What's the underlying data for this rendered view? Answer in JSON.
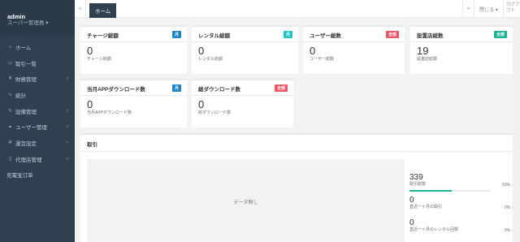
{
  "sidebar": {
    "user": "admin",
    "role": "スーパー管理員 ▾",
    "items": [
      {
        "label": "ホーム",
        "icon": "home-icon",
        "glyph": "⌂",
        "arrow": ""
      },
      {
        "label": "取引一覧",
        "icon": "list-icon",
        "glyph": "▭",
        "arrow": ""
      },
      {
        "label": "財務管理",
        "icon": "yen-icon",
        "glyph": "¥",
        "arrow": "‹"
      },
      {
        "label": "統計",
        "icon": "chart-icon",
        "glyph": "∿",
        "arrow": ""
      },
      {
        "label": "設備管理",
        "icon": "device-icon",
        "glyph": "✎",
        "arrow": "‹"
      },
      {
        "label": "ユーザー管理",
        "icon": "users-icon",
        "glyph": "⚭",
        "arrow": "‹"
      },
      {
        "label": "運営設定",
        "icon": "settings-icon",
        "glyph": "✲",
        "arrow": "‹"
      },
      {
        "label": "代理店管理",
        "icon": "agent-icon",
        "glyph": "▯",
        "arrow": "‹"
      },
      {
        "label": "充電宝订单",
        "icon": "",
        "glyph": "",
        "arrow": ""
      }
    ]
  },
  "topbar": {
    "back": "«",
    "tab_home": "ホーム",
    "forward": "»",
    "close_menu": "閉じる ▾",
    "logout": "ログアウト"
  },
  "cards": [
    {
      "title": "チャージ総額",
      "badge": "月",
      "badge_color": "#1c84c6",
      "value": "0",
      "sub": "チャージ総額"
    },
    {
      "title": "レンタル総額",
      "badge": "月",
      "badge_color": "#23c6c8",
      "value": "0",
      "sub": "レンタル総額"
    },
    {
      "title": "ユーザー総数",
      "badge": "全部",
      "badge_color": "#ed5565",
      "value": "0",
      "sub": "ユーザー総数"
    },
    {
      "title": "設置店総数",
      "badge": "全部",
      "badge_color": "#1ab394",
      "value": "19",
      "sub": "設置店総数"
    },
    {
      "title": "当月APPダウンロード数",
      "badge": "月",
      "badge_color": "#1c84c6",
      "value": "0",
      "sub": "当月APPダウンロード数"
    },
    {
      "title": "総ダウンロード数",
      "badge": "全部",
      "badge_color": "#ed5565",
      "value": "0",
      "sub": "総ダウンロード数"
    }
  ],
  "transactions": {
    "title": "取引",
    "empty": "データ無し",
    "stats": [
      {
        "value": "339",
        "label": "取引総数",
        "pct": "53%",
        "progress": 53
      },
      {
        "value": "0",
        "label": "直近一ヶ月の取引",
        "pct": "0%",
        "progress": 0
      },
      {
        "value": "0",
        "label": "直近一ヶ月のレンタル回数",
        "pct": "0%",
        "progress": 0
      }
    ]
  }
}
